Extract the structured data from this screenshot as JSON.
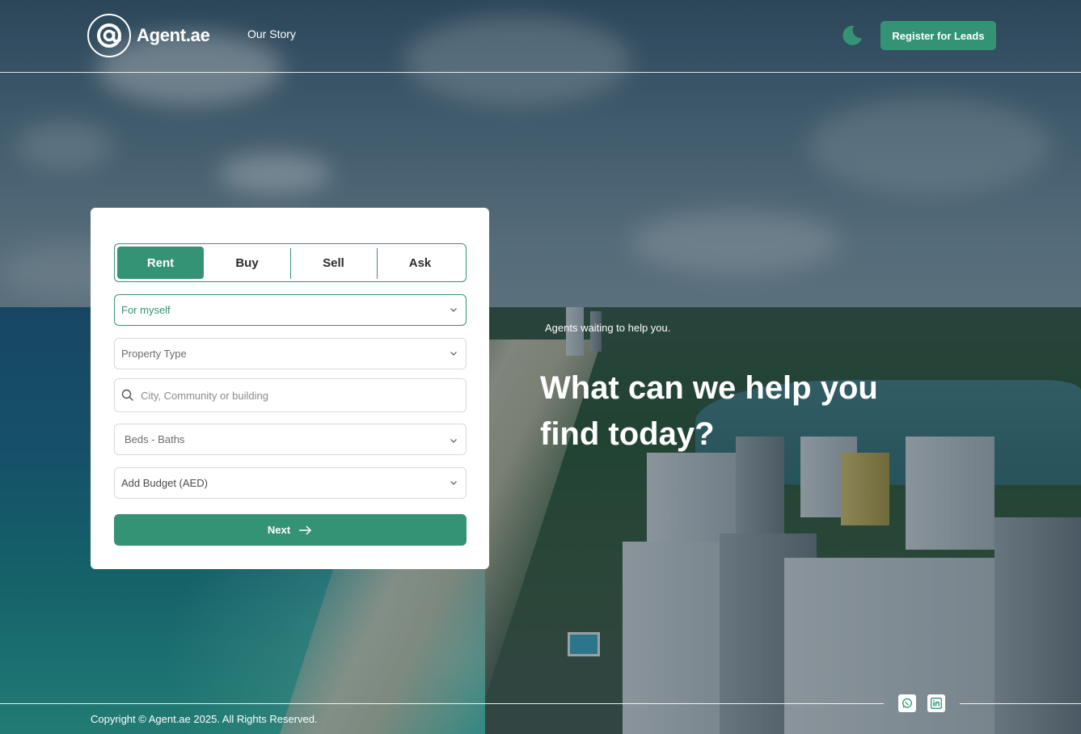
{
  "brand": {
    "name": "Agent.ae"
  },
  "nav": {
    "our_story": "Our Story"
  },
  "header": {
    "register_label": "Register for Leads"
  },
  "colors": {
    "accent": "#349375",
    "card_bg": "#ffffff"
  },
  "icons": {
    "logo": "at-sign-icon",
    "theme": "moon-icon",
    "search": "search-icon",
    "dropdown": "chevron-down-icon",
    "next": "arrow-right-icon",
    "whatsapp": "whatsapp-icon",
    "linkedin": "linkedin-icon"
  },
  "search_form": {
    "tabs": [
      {
        "label": "Rent",
        "active": true
      },
      {
        "label": "Buy",
        "active": false
      },
      {
        "label": "Sell",
        "active": false
      },
      {
        "label": "Ask",
        "active": false
      }
    ],
    "purpose_value": "For myself",
    "property_type_placeholder": "Property Type",
    "location_placeholder": "City, Community or building",
    "beds_baths_placeholder": "Beds - Baths",
    "budget_placeholder": "Add Budget (AED)",
    "next_label": "Next"
  },
  "hero": {
    "tagline": "Agents waiting to help you.",
    "headline": "What can we help you find today?"
  },
  "footer": {
    "copyright": "Copyright © Agent.ae 2025. All Rights Reserved."
  }
}
